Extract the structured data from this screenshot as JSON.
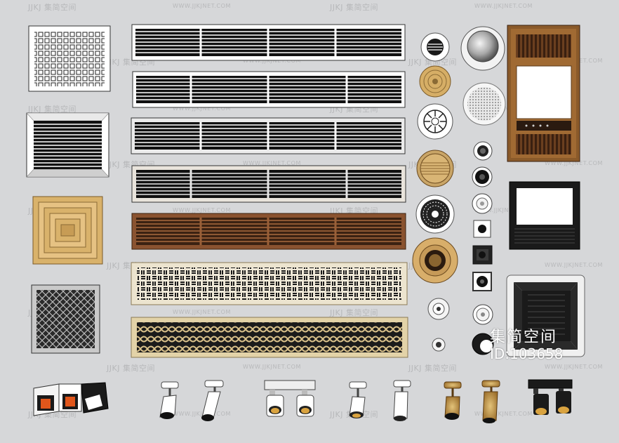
{
  "watermark": {
    "logo_text": "JJKJ",
    "brand_cn": "集简空间",
    "url": "WWW.JJKJNET.COM"
  },
  "id_overlay": {
    "title_cn": "集简空间",
    "id_text": "ID:103658"
  },
  "colors": {
    "background": "#d6d7d9",
    "wood_dark": "#7a4a2a",
    "wood_light": "#c9a567",
    "beige": "#e6dcc4",
    "black": "#111111",
    "white": "#ffffff",
    "accent_orange": "#e05a1b",
    "brass": "#b8843a"
  },
  "items": {
    "vents_left": [
      "square-diffuser-white",
      "louver-grille-white",
      "square-diffuser-wood",
      "decor-grille-black"
    ],
    "linear_grilles": [
      "linear-grille-white",
      "linear-grille-white",
      "linear-grille-white",
      "linear-grille-grey",
      "linear-grille-wood",
      "linear-grille-pattern-beige",
      "linear-grille-pattern-gold"
    ],
    "round_vents": [
      "round-vent-white",
      "round-vent-wood",
      "round-vent-swirl",
      "round-vent-wood-ring",
      "round-vent-radial",
      "round-vent-gold"
    ],
    "fixtures_right": [
      "ceiling-speaker",
      "mesh-speaker",
      "bath-heater-wood",
      "bath-heater-black",
      "cassette-ac"
    ],
    "downlights": [
      "downlight-1",
      "downlight-2",
      "downlight-3",
      "downlight-4",
      "downlight-5",
      "downlight-6",
      "downlight-7"
    ],
    "spotlights": [
      "double-box-spotlight",
      "track-spotlight-white",
      "track-spotlight-white-long",
      "twin-spotlight-white",
      "track-spotlight-white-2",
      "track-spotlight-white-long-2",
      "track-spotlight-brass",
      "track-spotlight-brass-long",
      "twin-spotlight-black"
    ]
  }
}
